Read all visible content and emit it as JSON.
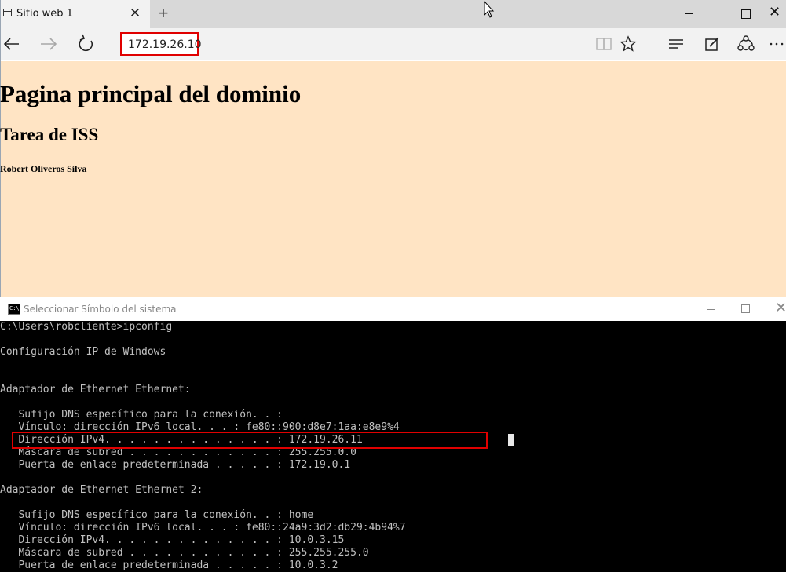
{
  "browser": {
    "tab": {
      "title": "Sitio web 1",
      "close": "✕"
    },
    "new_tab": "+",
    "address": "172.19.26.10",
    "page": {
      "h1": "Pagina principal del dominio",
      "h2": "Tarea de ISS",
      "h5": "Robert Oliveros Silva"
    },
    "colors": {
      "page_background": "#ffe4c4",
      "highlight": "#e00000"
    }
  },
  "cmd": {
    "title": "Seleccionar Símbolo del sistema",
    "icon_text": "C:\\.",
    "close": "✕",
    "lines": [
      "C:\\Users\\robcliente>ipconfig",
      "",
      "Configuración IP de Windows",
      "",
      "",
      "Adaptador de Ethernet Ethernet:",
      "",
      "   Sufijo DNS específico para la conexión. . :",
      "   Vínculo: dirección IPv6 local. . . : fe80::900:d8e7:1aa:e8e9%4",
      "   Dirección IPv4. . . . . . . . . . . . . . : 172.19.26.11",
      "   Máscara de subred . . . . . . . . . . . . : 255.255.0.0",
      "   Puerta de enlace predeterminada . . . . . : 172.19.0.1",
      "",
      "Adaptador de Ethernet Ethernet 2:",
      "",
      "   Sufijo DNS específico para la conexión. . : home",
      "   Vínculo: dirección IPv6 local. . . : fe80::24a9:3d2:db29:4b94%7",
      "   Dirección IPv4. . . . . . . . . . . . . . : 10.0.3.15",
      "   Máscara de subred . . . . . . . . . . . . : 255.255.255.0",
      "   Puerta de enlace predeterminada . . . . . : 10.0.3.2"
    ]
  }
}
